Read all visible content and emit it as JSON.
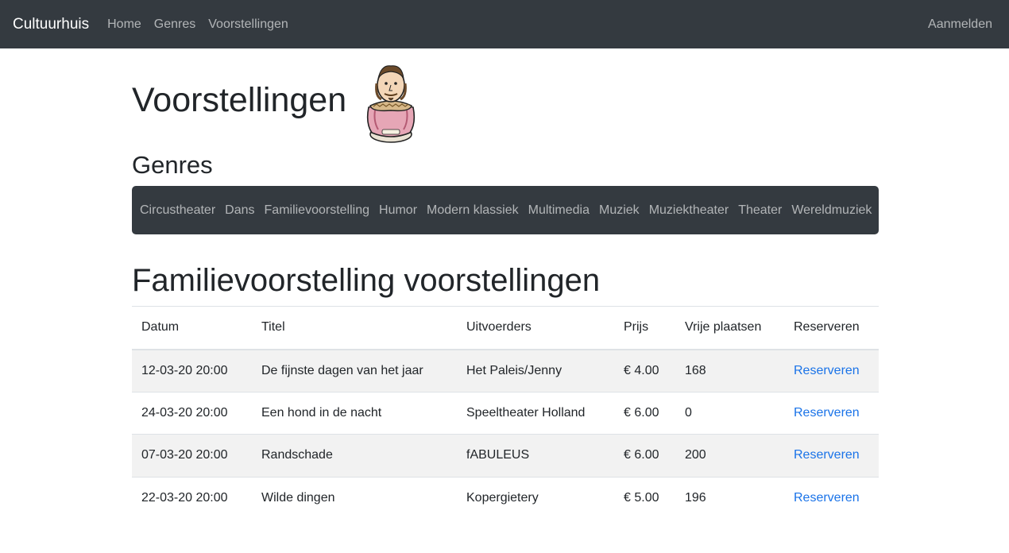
{
  "navbar": {
    "brand": "Cultuurhuis",
    "links": [
      "Home",
      "Genres",
      "Voorstellingen"
    ],
    "login": "Aanmelden"
  },
  "header": {
    "title": "Voorstellingen",
    "mascot_icon": "shakespeare-bust-icon"
  },
  "genres": {
    "heading": "Genres",
    "items": [
      "Circustheater",
      "Dans",
      "Familievoorstelling",
      "Humor",
      "Modern klassiek",
      "Multimedia",
      "Muziek",
      "Muziektheater",
      "Theater",
      "Wereldmuziek"
    ]
  },
  "section": {
    "title": "Familievoorstelling voorstellingen"
  },
  "table": {
    "headers": [
      "Datum",
      "Titel",
      "Uitvoerders",
      "Prijs",
      "Vrije plaatsen",
      "Reserveren"
    ],
    "rows": [
      {
        "datum": "12-03-20 20:00",
        "titel": "De fijnste dagen van het jaar",
        "uitvoerders": "Het Paleis/Jenny",
        "prijs": "€ 4.00",
        "vrij": "168",
        "reserveren": "Reserveren"
      },
      {
        "datum": "24-03-20 20:00",
        "titel": "Een hond in de nacht",
        "uitvoerders": "Speeltheater Holland",
        "prijs": "€ 6.00",
        "vrij": "0",
        "reserveren": "Reserveren"
      },
      {
        "datum": "07-03-20 20:00",
        "titel": "Randschade",
        "uitvoerders": "fABULEUS",
        "prijs": "€ 6.00",
        "vrij": "200",
        "reserveren": "Reserveren"
      },
      {
        "datum": "22-03-20 20:00",
        "titel": "Wilde dingen",
        "uitvoerders": "Kopergietery",
        "prijs": "€ 5.00",
        "vrij": "196",
        "reserveren": "Reserveren"
      }
    ]
  },
  "colors": {
    "navbar_bg": "#343a40",
    "link_blue": "#1a73e8",
    "stripe": "#f2f2f2"
  }
}
